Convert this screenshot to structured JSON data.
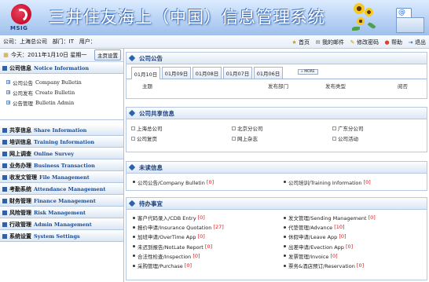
{
  "header": {
    "logo_text": "MSIG",
    "title": "三井住友海上（中国）信息管理系统"
  },
  "infobar": {
    "company_label": "公司：上海总公司",
    "dept_label": "部门：IT",
    "user_label": "用户：",
    "nav": [
      {
        "icon": "home-icon",
        "label": "首页"
      },
      {
        "icon": "mail-icon",
        "label": "我的邮件"
      },
      {
        "icon": "key-icon",
        "label": "修改密码"
      },
      {
        "icon": "help-icon",
        "label": "帮助"
      },
      {
        "icon": "exit-icon",
        "label": "退出"
      }
    ]
  },
  "sidebar": {
    "date": "今天：2011年1月10日 星期一",
    "home_button": "主页设置",
    "menus": [
      {
        "cn": "公司信息",
        "en": "Notice Information",
        "subs": [
          {
            "cn": "公司公告",
            "en": "Company Bulletin"
          },
          {
            "cn": "公司发布",
            "en": "Create Bulletin"
          },
          {
            "cn": "公告管理",
            "en": "Bulletin Admin"
          }
        ]
      },
      {
        "cn": "共享信息",
        "en": "Share Information"
      },
      {
        "cn": "培训信息",
        "en": "Training Information"
      },
      {
        "cn": "网上调查",
        "en": "Online Survey"
      },
      {
        "cn": "业务办理",
        "en": "Business Transaction"
      },
      {
        "cn": "收发文管理",
        "en": "File Management"
      },
      {
        "cn": "考勤系统",
        "en": "Attendance Management"
      },
      {
        "cn": "财务管理",
        "en": "Finance Management"
      },
      {
        "cn": "风险管理",
        "en": "Risk Management"
      },
      {
        "cn": "行政管理",
        "en": "Admin Management"
      },
      {
        "cn": "系统设置",
        "en": "System Settings"
      }
    ]
  },
  "announcements": {
    "title": "公司公告",
    "tabs": [
      "01月10日",
      "01月09日",
      "01月08日",
      "01月07日",
      "01月06日"
    ],
    "active_tab": 0,
    "more": "MORE",
    "columns": [
      "主题",
      "发布部门",
      "发布类型",
      "阅否"
    ]
  },
  "shared": {
    "title": "公司共享信息",
    "items": [
      "上海总公司",
      "北京分公司",
      "广东分公司",
      "公司复页",
      "网上杂志",
      "公司活动"
    ]
  },
  "unread": {
    "title": "未读信息",
    "items": [
      {
        "label": "公司公告/Company Bulletin",
        "count": "[0]"
      },
      {
        "label": "公司培训/Training Information",
        "count": "[0]"
      }
    ]
  },
  "todo": {
    "title": "待办事宜",
    "left": [
      {
        "label": "客户代码录入/CDB Entry",
        "count": "[0]"
      },
      {
        "label": "报价申请/Insurance Quotation",
        "count": "[27]"
      },
      {
        "label": "加班申请/OverTime App",
        "count": "[0]"
      },
      {
        "label": "未迟到报告/NotLate Report",
        "count": "[0]"
      },
      {
        "label": "合法性检查/Inspection",
        "count": "[0]"
      },
      {
        "label": "采购管理/Purchase",
        "count": "[0]"
      }
    ],
    "right": [
      {
        "label": "发文管理/Sending Management",
        "count": "[0]"
      },
      {
        "label": "代垫管理/Advance",
        "count": "[10]"
      },
      {
        "label": "休假申请/Leave App",
        "count": "[0]"
      },
      {
        "label": "出差申请/Evection App",
        "count": "[0]"
      },
      {
        "label": "发票管理/Invoice",
        "count": "[0]"
      },
      {
        "label": "票务&酒店预订/Reservation",
        "count": "[0]"
      }
    ]
  }
}
